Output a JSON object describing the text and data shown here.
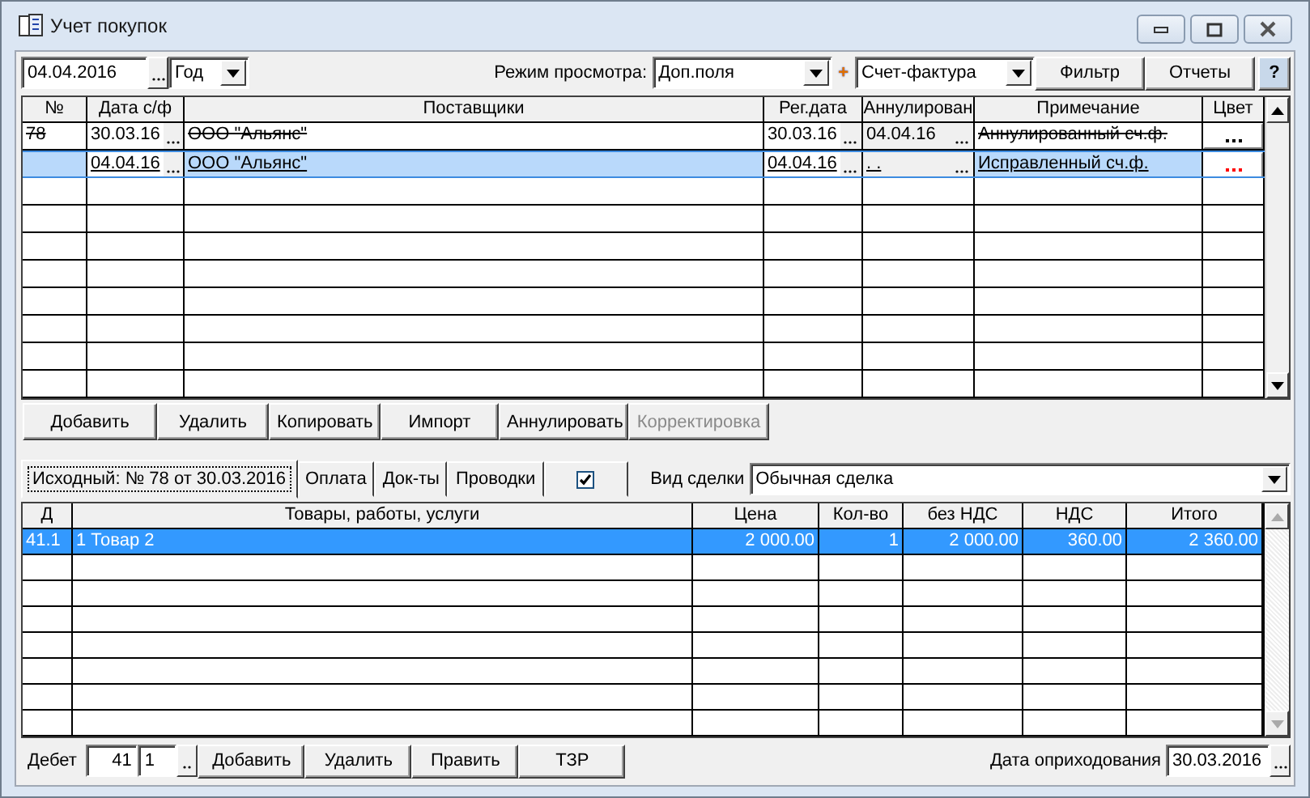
{
  "window": {
    "title": "Учет покупок"
  },
  "toolbar": {
    "date": "04.04.2016",
    "period": "Год",
    "view_mode_label": "Режим просмотра:",
    "view_mode": "Доп.поля",
    "plus": "+",
    "doc_type": "Счет-фактура",
    "buttons": [
      "Фильтр",
      "Отчеты"
    ],
    "help": "?"
  },
  "invoices": {
    "columns": [
      "№",
      "Дата с/ф",
      "Поставщики",
      "Рег.дата",
      "Аннулирован",
      "Примечание",
      "Цвет"
    ],
    "rows": [
      {
        "number": "78",
        "date": "30.03.16",
        "supplier": "ООО \"Альянс\"",
        "reg_date": "30.03.16",
        "annulled_date": "04.04.16",
        "note": "Аннулированный сч.ф.",
        "color": "#000000",
        "annulled": true,
        "selected": false
      },
      {
        "date": "04.04.16",
        "supplier": "ООО \"Альянс\"",
        "reg_date": "04.04.16",
        "annulled_date": ". .",
        "note": "Исправленный сч.ф.",
        "color": "#ff0000",
        "annulled": false,
        "selected": true
      }
    ]
  },
  "actions": [
    {
      "label": "Добавить",
      "disabled": false
    },
    {
      "label": "Удалить",
      "disabled": false
    },
    {
      "label": "Копировать",
      "disabled": false
    },
    {
      "label": "Импорт",
      "disabled": false
    },
    {
      "label": "Аннулировать",
      "disabled": false
    },
    {
      "label": "Корректировка",
      "disabled": true
    }
  ],
  "tabs": [
    {
      "kind": "text",
      "label": "Исходный: № 78 от 30.03.2016",
      "selected": true
    },
    {
      "kind": "text",
      "label": "Оплата",
      "selected": false
    },
    {
      "kind": "text",
      "label": "Док-ты",
      "selected": false
    },
    {
      "kind": "text",
      "label": "Проводки",
      "selected": false
    },
    {
      "kind": "checkbox",
      "checked": true,
      "selected": false
    }
  ],
  "deal_type": {
    "label": "Вид сделки",
    "value": "Обычная сделка"
  },
  "items": {
    "columns": [
      "Д",
      "Товары, работы, услуги",
      "Цена",
      "Кол-во",
      "без НДС",
      "НДС",
      "Итого"
    ],
    "rows": [
      {
        "account": "41.1",
        "name": "1 Товар 2",
        "price": "2 000.00",
        "qty": "1",
        "net": "2 000.00",
        "vat": "360.00",
        "total": "2 360.00",
        "selected": true
      }
    ]
  },
  "footer": {
    "debit_label": "Дебет",
    "account": "41",
    "subaccount": "1",
    "buttons": [
      "Добавить",
      "Удалить",
      "Править",
      "ТЗР"
    ],
    "date_label": "Дата оприходования",
    "date": "30.03.2016"
  }
}
